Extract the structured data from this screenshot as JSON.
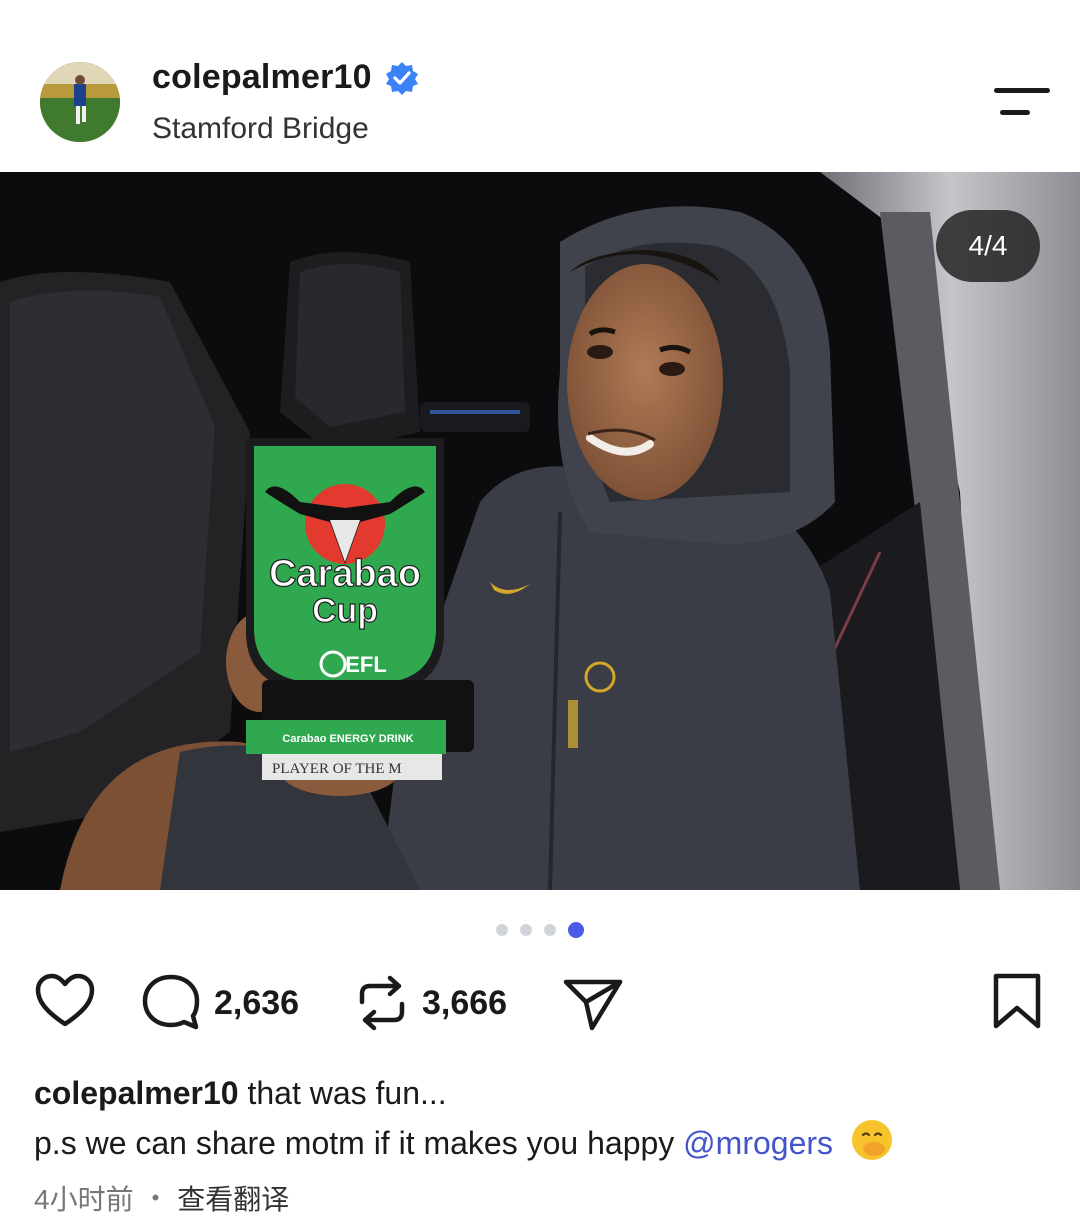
{
  "post": {
    "username": "colepalmer10",
    "location": "Stamford Bridge",
    "verified": true,
    "image_counter": "4/4",
    "trophy_text": {
      "brand_line1": "Carabao",
      "brand_line2": "Cup",
      "league": "EFL",
      "plinth_top": "Carabao ENERGY DRINK",
      "plinth_bottom": "PLAYER OF THE M"
    },
    "carousel": {
      "total": 4,
      "current": 4
    }
  },
  "actions": {
    "comments_count": "2,636",
    "reposts_count": "3,666"
  },
  "caption": {
    "username": "colepalmer10",
    "line1": "that was fun...",
    "line2_prefix": "p.s we can share motm if it makes you happy",
    "mention": "mrogers",
    "mention_symbol": "@"
  },
  "meta": {
    "time_ago": "4小时前",
    "separator": "•",
    "translate": "查看翻译"
  },
  "icons": [
    "verified-badge-icon",
    "menu-icon",
    "heart-icon",
    "comment-icon",
    "repost-icon",
    "share-icon",
    "bookmark-icon",
    "hand-over-mouth-emoji"
  ],
  "colors": {
    "verified": "#3b82f6",
    "mention": "#4455cc",
    "active_dot": "#4b5ce6",
    "trophy_green": "#2fa84f",
    "trophy_red": "#e23a2e"
  }
}
